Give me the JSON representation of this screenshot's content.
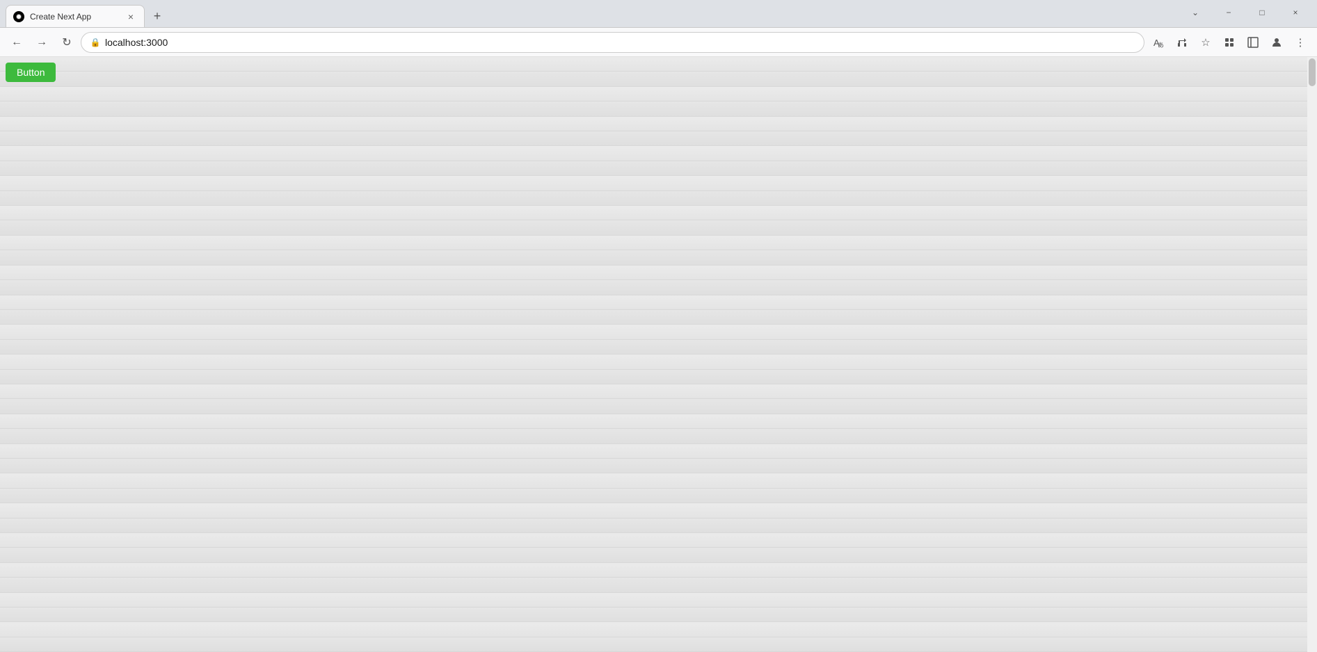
{
  "browser": {
    "tab": {
      "title": "Create Next App",
      "favicon_alt": "Next.js logo"
    },
    "address_bar": {
      "url": "localhost:3000",
      "icon": "🔒"
    },
    "title_bar": {
      "minimize": "−",
      "maximize": "□",
      "close": "×",
      "dropdown": "⌄",
      "new_tab_label": "+"
    },
    "nav": {
      "back": "←",
      "forward": "→",
      "refresh": "↻"
    },
    "toolbar_icons": {
      "translate": "A",
      "share": "↗",
      "favorite": "☆",
      "extensions": "🧩",
      "sidebar": "▦",
      "profile": "👤",
      "menu": "⋮"
    }
  },
  "page": {
    "button_label": "Button",
    "button_color": "#3dba3d",
    "stripe_count": 40
  }
}
